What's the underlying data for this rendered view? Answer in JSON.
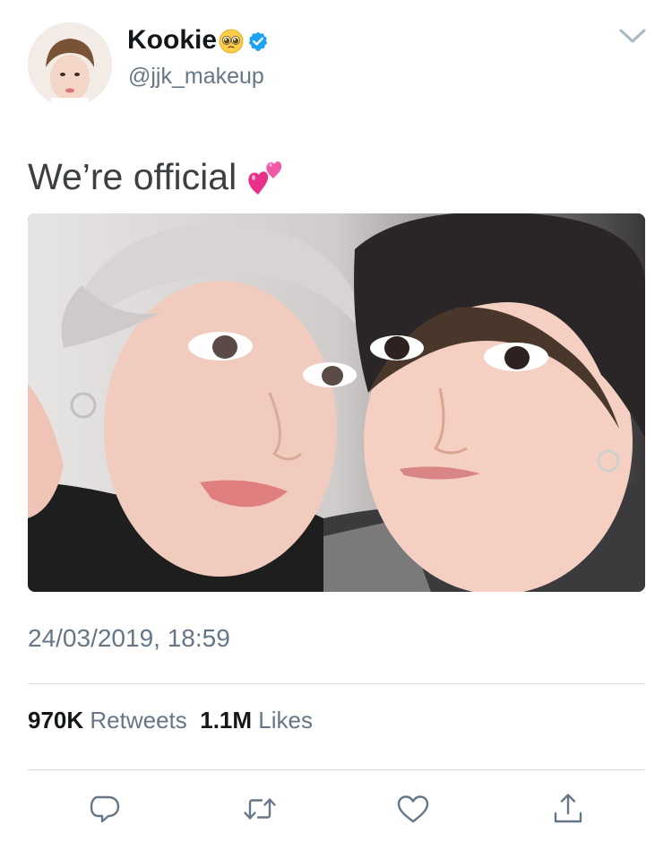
{
  "tweet": {
    "author": {
      "display_name": "Kookie",
      "name_emoji": "pleading-face-emoji",
      "verified": true,
      "handle": "@jjk_makeup"
    },
    "text": "We’re official",
    "text_emoji": "two-hearts-emoji",
    "timestamp": "24/03/2019, 18:59",
    "stats": {
      "retweets_count": "970K",
      "retweets_label": "Retweets",
      "likes_count": "1.1M",
      "likes_label": "Likes"
    },
    "actions": [
      {
        "icon": "reply-icon"
      },
      {
        "icon": "retweet-icon"
      },
      {
        "icon": "like-icon"
      },
      {
        "icon": "share-icon"
      }
    ]
  },
  "colors": {
    "text": "#14171a",
    "secondary_text": "#657786",
    "verified_blue": "#1da1f2",
    "divider": "#d8dee3"
  }
}
